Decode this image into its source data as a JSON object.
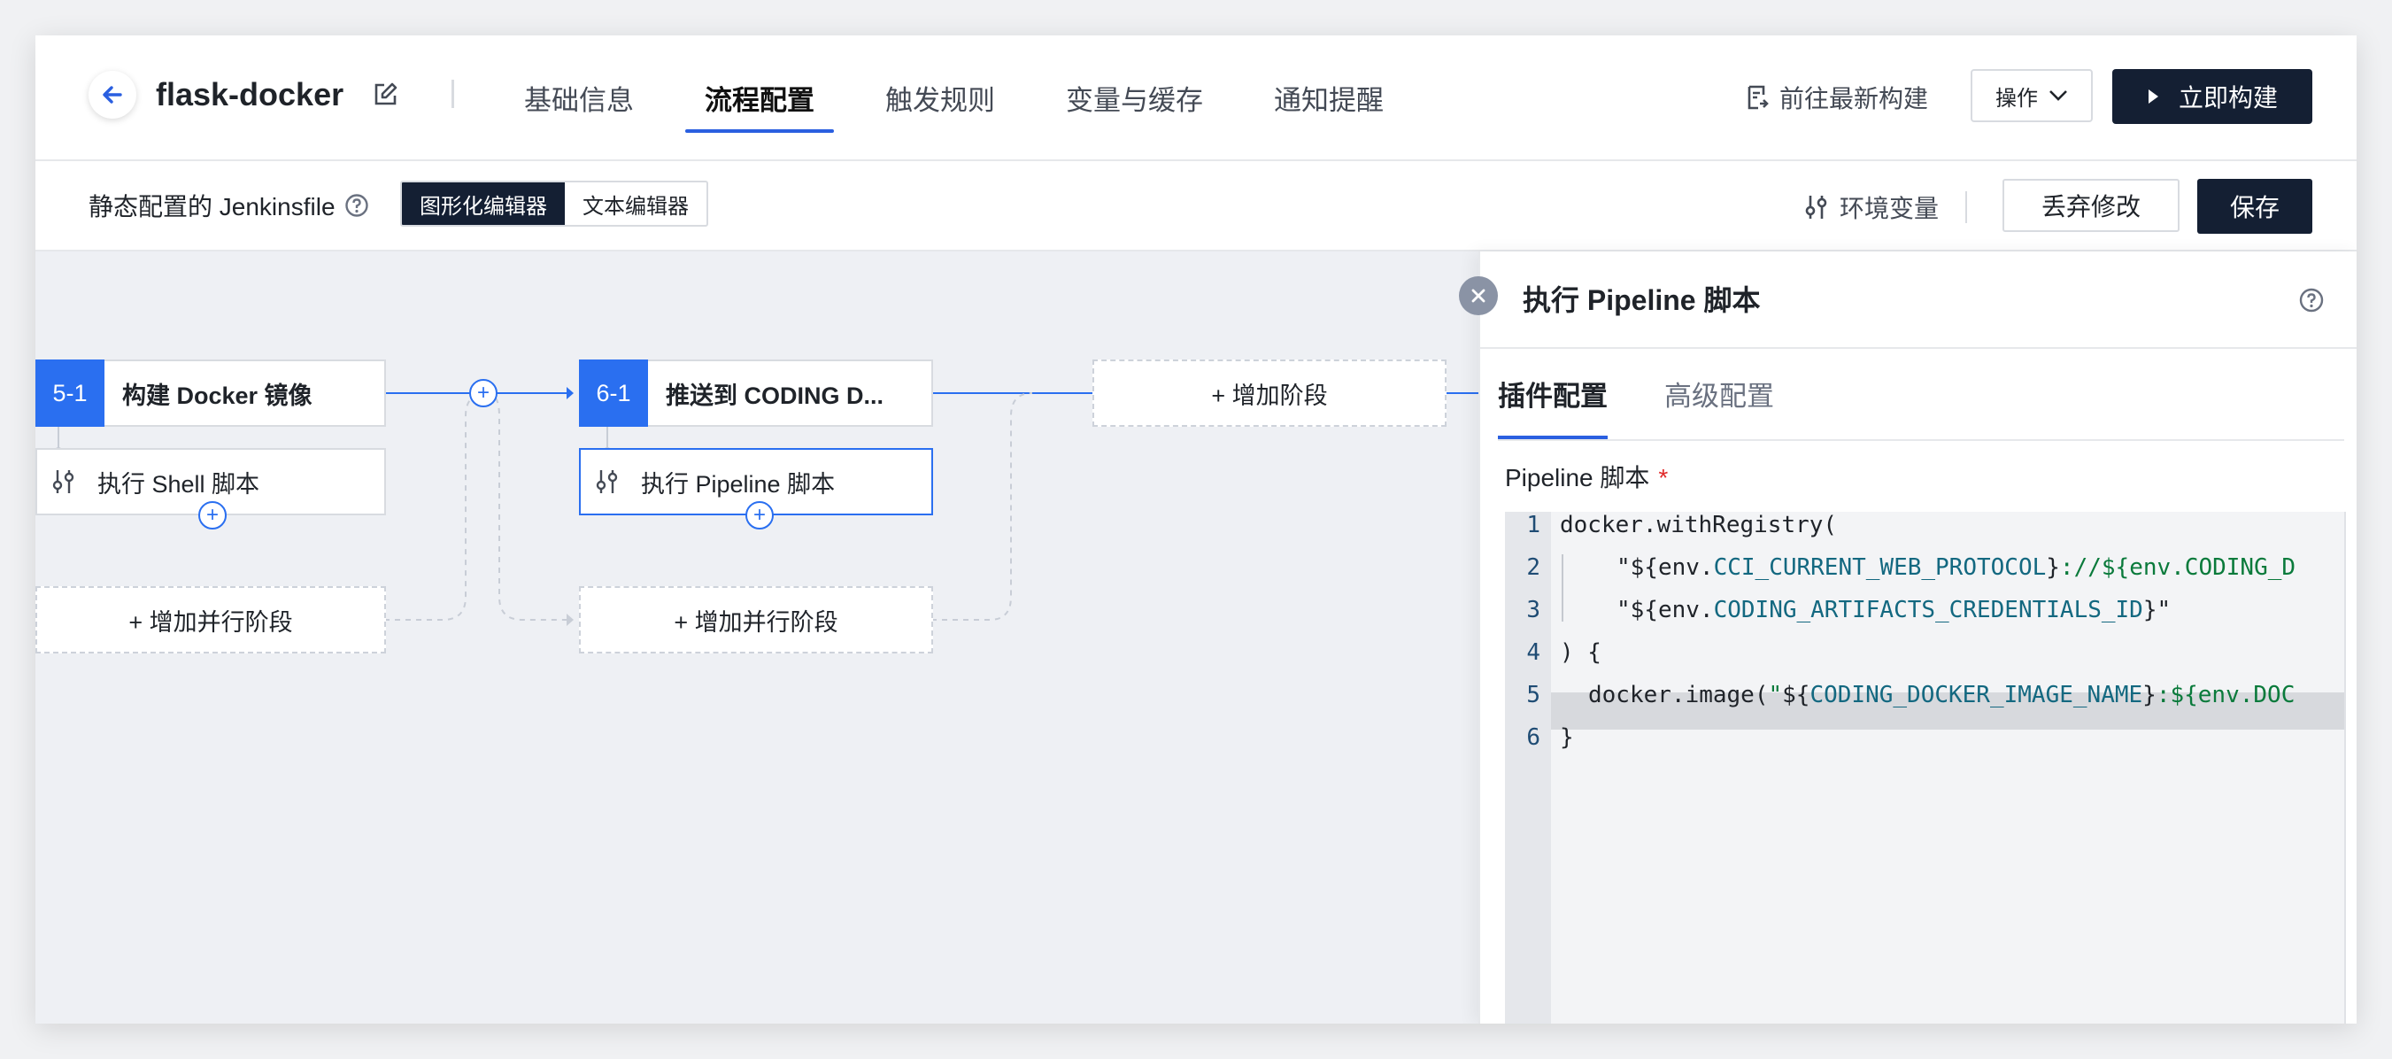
{
  "header": {
    "project_name": "flask-docker",
    "tabs": [
      {
        "label": "基础信息",
        "active": false
      },
      {
        "label": "流程配置",
        "active": true
      },
      {
        "label": "触发规则",
        "active": false
      },
      {
        "label": "变量与缓存",
        "active": false
      },
      {
        "label": "通知提醒",
        "active": false
      }
    ],
    "goto_latest_label": "前往最新构建",
    "ops_label": "操作",
    "build_label": "立即构建"
  },
  "subbar": {
    "jenkinsfile_label": "静态配置的 Jenkinsfile",
    "editor_modes": [
      {
        "label": "图形化编辑器",
        "active": true
      },
      {
        "label": "文本编辑器",
        "active": false
      }
    ],
    "env_vars_label": "环境变量",
    "discard_label": "丢弃修改",
    "save_label": "保存"
  },
  "pipeline": {
    "stages": [
      {
        "num": "5-1",
        "name": "构建 Docker 镜像",
        "job": "执行 Shell 脚本"
      },
      {
        "num": "6-1",
        "name": "推送到 CODING D...",
        "job": "执行 Pipeline 脚本"
      }
    ],
    "add_stage_label": "+ 增加阶段",
    "add_parallel_label": "+ 增加并行阶段"
  },
  "panel": {
    "title": "执行 Pipeline 脚本",
    "tabs": [
      {
        "label": "插件配置",
        "active": true
      },
      {
        "label": "高级配置",
        "active": false
      }
    ],
    "field_label": "Pipeline 脚本",
    "required_mark": "*",
    "code": {
      "line_numbers": [
        "1",
        "2",
        "3",
        "4",
        "5",
        "6"
      ],
      "l1": "docker.withRegistry(",
      "l2": {
        "a": "\"${env.",
        "b": "CCI_CURRENT_WEB_PROTOCOL",
        "c": "}",
        "d": "://${env.CODING_D"
      },
      "l3": {
        "a": "\"${env.",
        "b": "CODING_ARTIFACTS_CREDENTIALS_ID",
        "c": "}\""
      },
      "l4": ") {",
      "l5": {
        "a": "docker.image(",
        "b": "\"",
        "c": "${",
        "d": "CODING_DOCKER_IMAGE_NAME",
        "e": "}",
        "f": ":${env.DOC"
      },
      "l6": "}"
    }
  },
  "colors": {
    "accent": "#2a6ff0",
    "primary_dark": "#141f33",
    "required": "#e02a2a"
  }
}
